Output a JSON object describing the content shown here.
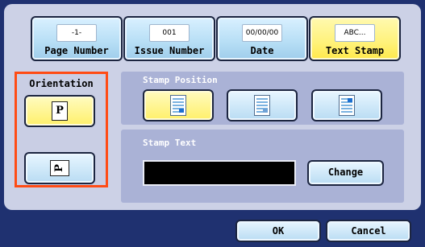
{
  "tabs": [
    {
      "tag": "-1-",
      "label": "Page Number",
      "active": false
    },
    {
      "tag": "001",
      "label": "Issue Number",
      "active": false
    },
    {
      "tag": "00/00/00",
      "label": "Date",
      "active": false
    },
    {
      "tag": "ABC...",
      "label": "Text Stamp",
      "active": true
    }
  ],
  "orientation": {
    "title": "Orientation",
    "options": [
      {
        "glyph": "P",
        "selected": true
      },
      {
        "glyph": "P",
        "selected": false
      }
    ]
  },
  "stamp_position": {
    "title": "Stamp Position",
    "options": [
      "bottom-right",
      "middle-right",
      "top-right"
    ],
    "selected": "bottom-right"
  },
  "stamp_text": {
    "title": "Stamp Text",
    "value": "",
    "change_label": "Change"
  },
  "footer": {
    "ok_label": "OK",
    "cancel_label": "Cancel"
  },
  "colors": {
    "background": "#1f3170",
    "panel": "#ccd1e6",
    "active": "#fff06a",
    "highlight_border": "#ff4b14"
  }
}
